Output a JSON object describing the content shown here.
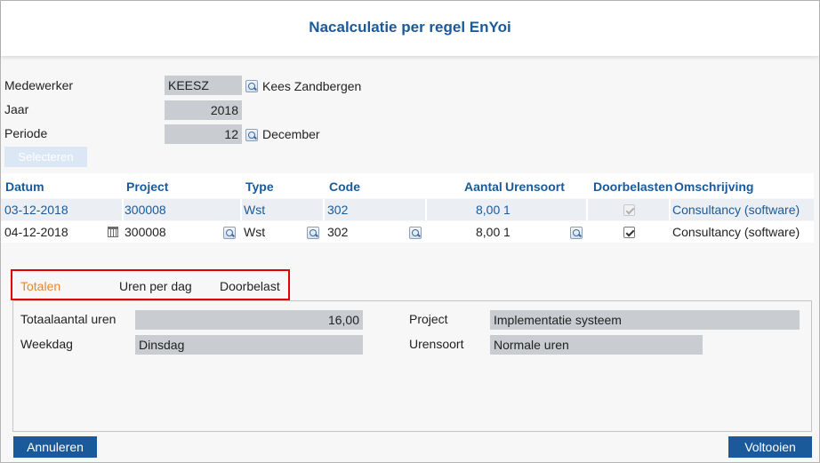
{
  "window": {
    "title": "Nacalculatie per regel EnYoi"
  },
  "filters": {
    "medewerker_label": "Medewerker",
    "medewerker_value": "KEESZ",
    "medewerker_name": "Kees Zandbergen",
    "jaar_label": "Jaar",
    "jaar_value": "2018",
    "periode_label": "Periode",
    "periode_value": "12",
    "periode_name": "December",
    "select_button": "Selecteren"
  },
  "grid": {
    "columns": [
      "Datum",
      "Project",
      "Type",
      "Code",
      "Aantal",
      "Urensoort",
      "Doorbelasten",
      "Omschrijving"
    ],
    "rows": [
      {
        "datum": "03-12-2018",
        "project": "300008",
        "type": "Wst",
        "code": "302",
        "aantal": "8,00",
        "urensoort": "1",
        "doorbelasten": true,
        "omschrijving": "Consultancy (software)"
      },
      {
        "datum": "04-12-2018",
        "project": "300008",
        "type": "Wst",
        "code": "302",
        "aantal": "8,00",
        "urensoort": "1",
        "doorbelasten": true,
        "omschrijving": "Consultancy (software)"
      }
    ]
  },
  "tabs": [
    {
      "label": "Totalen",
      "active": true
    },
    {
      "label": "Uren per dag",
      "active": false
    },
    {
      "label": "Doorbelast",
      "active": false
    }
  ],
  "totals": {
    "totaal_label": "Totaalaantal uren",
    "totaal_value": "16,00",
    "weekdag_label": "Weekdag",
    "weekdag_value": "Dinsdag",
    "project_label": "Project",
    "project_value": "Implementatie systeem",
    "urensoort_label": "Urensoort",
    "urensoort_value": "Normale uren"
  },
  "footer": {
    "cancel_label": "Annuleren",
    "finish_label": "Voltooien"
  },
  "colors": {
    "accent": "#1a5a9a",
    "active_tab": "#e8872e",
    "highlight_box": "#e00000",
    "field_bg": "#c9ccd1"
  }
}
